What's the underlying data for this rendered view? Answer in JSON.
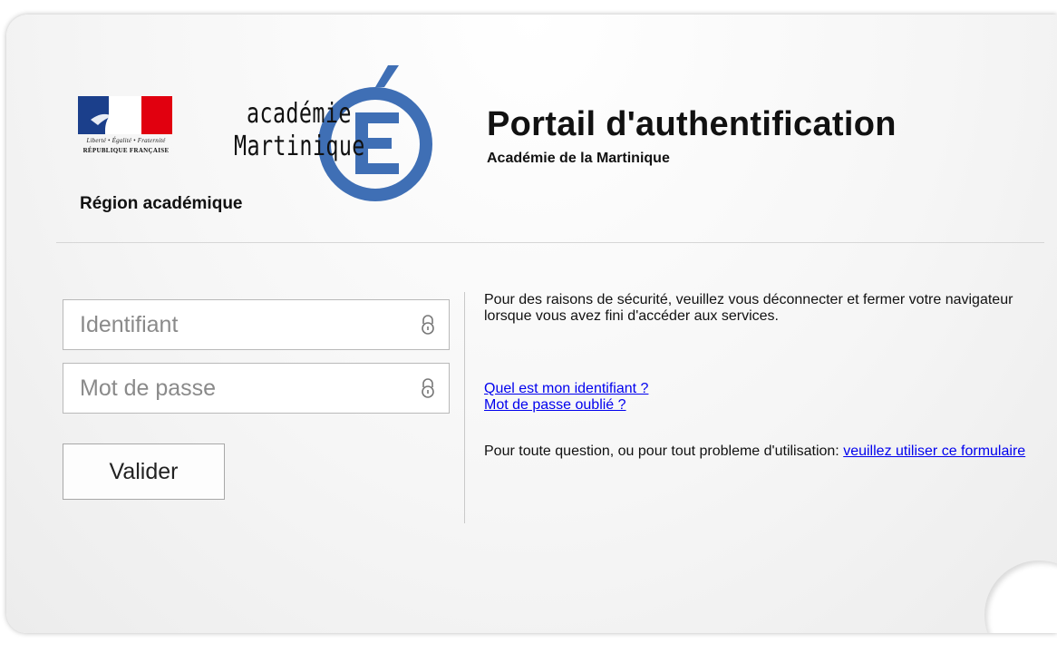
{
  "logos": {
    "republic_motto": "Liberté • Égalité • Fraternité",
    "republic_name": "RÉPUBLIQUE FRANÇAISE",
    "academy_word1": "académie",
    "academy_word2": "Martinique",
    "region_label": "Région académique",
    "colors": {
      "blue": "#1b3f8b",
      "red": "#e1000f",
      "academy_e": "#3f6fb5"
    }
  },
  "header": {
    "title": "Portail d'authentification",
    "subtitle": "Académie de la Martinique"
  },
  "form": {
    "username_placeholder": "Identifiant",
    "password_placeholder": "Mot de passe",
    "username_icon": "lock-icon",
    "password_icon": "lock-icon",
    "submit_label": "Valider"
  },
  "info": {
    "security_notice": "Pour des raisons de sécurité, veuillez vous déconnecter et fermer votre navigateur lorsque vous avez fini d'accéder aux services.",
    "link_identifier": "Quel est mon identifiant ?",
    "link_password": "Mot de passe oublié ?",
    "question_text": "Pour toute question, ou pour tout probleme d'utilisation: ",
    "question_link": "veuillez utiliser ce formulaire"
  }
}
